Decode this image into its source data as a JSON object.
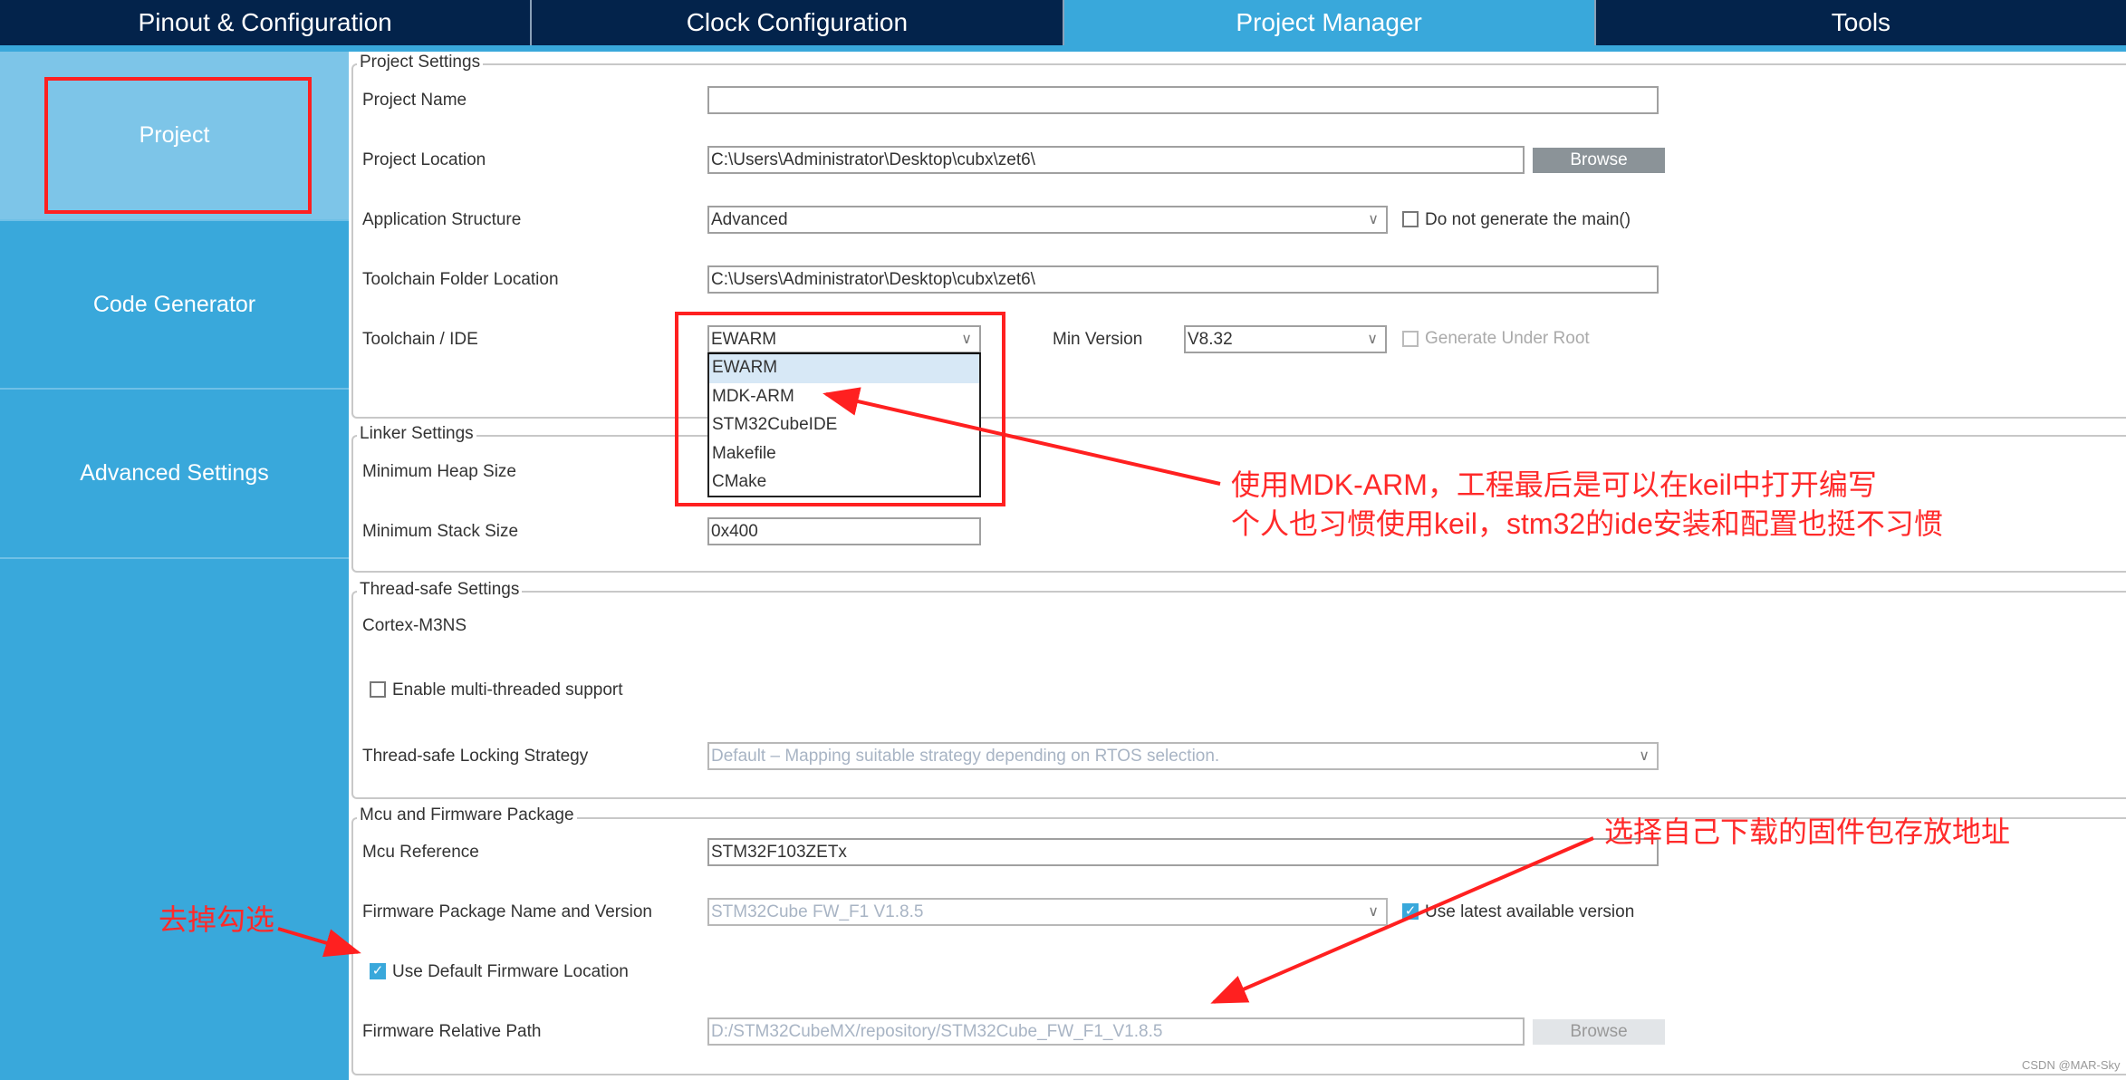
{
  "tabs": [
    {
      "label": "Pinout & Configuration"
    },
    {
      "label": "Clock Configuration"
    },
    {
      "label": "Project Manager",
      "active": true
    },
    {
      "label": "Tools"
    }
  ],
  "sidebar": {
    "items": [
      {
        "label": "Project",
        "active": true
      },
      {
        "label": "Code Generator"
      },
      {
        "label": "Advanced Settings"
      }
    ]
  },
  "project_settings": {
    "title": "Project Settings",
    "project_name_label": "Project Name",
    "project_name_value": "",
    "project_location_label": "Project Location",
    "project_location_value": "C:\\Users\\Administrator\\Desktop\\cubx\\zet6\\",
    "browse_label": "Browse",
    "app_structure_label": "Application Structure",
    "app_structure_value": "Advanced",
    "no_main_label": "Do not generate the main()",
    "toolchain_folder_label": "Toolchain Folder Location",
    "toolchain_folder_value": "C:\\Users\\Administrator\\Desktop\\cubx\\zet6\\",
    "toolchain_label": "Toolchain / IDE",
    "toolchain_value": "EWARM",
    "toolchain_options": [
      "EWARM",
      "MDK-ARM",
      "STM32CubeIDE",
      "Makefile",
      "CMake"
    ],
    "min_version_label": "Min Version",
    "min_version_value": "V8.32",
    "generate_under_root_label": "Generate Under Root"
  },
  "linker_settings": {
    "title": "Linker Settings",
    "heap_label": "Minimum Heap Size",
    "stack_label": "Minimum Stack Size",
    "stack_value": "0x400"
  },
  "thread_safe": {
    "title": "Thread-safe Settings",
    "core": "Cortex-M3NS",
    "multi_thread_label": "Enable multi-threaded support",
    "strategy_label": "Thread-safe Locking Strategy",
    "strategy_value": "Default  –  Mapping suitable strategy depending on RTOS selection."
  },
  "mcu_firmware": {
    "title": "Mcu and Firmware Package",
    "mcu_ref_label": "Mcu Reference",
    "mcu_ref_value": "STM32F103ZETx",
    "fw_pkg_label": "Firmware Package Name and Version",
    "fw_pkg_value": "STM32Cube FW_F1 V1.8.5",
    "use_latest_label": "Use latest available version",
    "use_default_label": "Use Default Firmware Location",
    "fw_path_label": "Firmware Relative Path",
    "fw_path_value": "D:/STM32CubeMX/repository/STM32Cube_FW_F1_V1.8.5",
    "browse_label": "Browse"
  },
  "annotations": {
    "mdk_line1": "使用MDK-ARM，工程最后是可以在keil中打开编写",
    "mdk_line2": "个人也习惯使用keil，stm32的ide安装和配置也挺不习惯",
    "fw_location": "选择自己下载的固件包存放地址",
    "uncheck": "去掉勾选",
    "color": "#ff2a2a"
  },
  "watermark": "CSDN @MAR-Sky"
}
